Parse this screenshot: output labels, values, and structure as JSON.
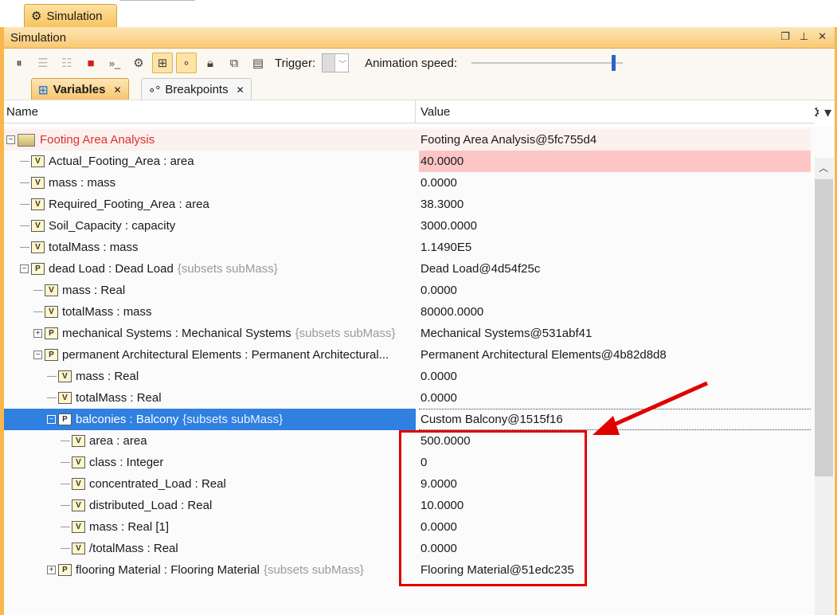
{
  "top_tab": {
    "label": "Simulation",
    "icon": "gear-icon"
  },
  "panel": {
    "title": "Simulation",
    "window_controls": [
      "restore-icon",
      "pin-icon",
      "close-icon"
    ]
  },
  "toolbar": {
    "trigger_label": "Trigger:",
    "animation_label": "Animation speed:",
    "animation_speed_fraction": 0.95
  },
  "subtabs": [
    {
      "label": "Variables",
      "active": true
    },
    {
      "label": "Breakpoints",
      "active": false
    }
  ],
  "columns": {
    "name": "Name",
    "value": "Value"
  },
  "rows": [
    {
      "indent": 0,
      "kind": "root",
      "expander": "minus",
      "name": "Footing Area Analysis",
      "subsets": "",
      "value": "Footing Area Analysis@5fc755d4"
    },
    {
      "indent": 1,
      "kind": "V",
      "expander": "",
      "name": "Actual_Footing_Area : area",
      "subsets": "",
      "value": "40.0000",
      "changed": true
    },
    {
      "indent": 1,
      "kind": "V",
      "expander": "",
      "name": "mass : mass",
      "subsets": "",
      "value": "0.0000"
    },
    {
      "indent": 1,
      "kind": "V",
      "expander": "",
      "name": "Required_Footing_Area : area",
      "subsets": "",
      "value": "38.3000"
    },
    {
      "indent": 1,
      "kind": "V",
      "expander": "",
      "name": "Soil_Capacity : capacity",
      "subsets": "",
      "value": "3000.0000"
    },
    {
      "indent": 1,
      "kind": "V",
      "expander": "",
      "name": "totalMass : mass",
      "subsets": "",
      "value": "1.1490E5"
    },
    {
      "indent": 1,
      "kind": "P",
      "expander": "minus",
      "name": "dead Load : Dead Load",
      "subsets": "{subsets subMass}",
      "value": "Dead Load@4d54f25c"
    },
    {
      "indent": 2,
      "kind": "V",
      "expander": "",
      "name": "mass : Real",
      "subsets": "",
      "value": "0.0000"
    },
    {
      "indent": 2,
      "kind": "V",
      "expander": "",
      "name": "totalMass : mass",
      "subsets": "",
      "value": "80000.0000"
    },
    {
      "indent": 2,
      "kind": "P",
      "expander": "plus",
      "name": "mechanical Systems : Mechanical Systems",
      "subsets": "{subsets subMass}",
      "value": "Mechanical Systems@531abf41"
    },
    {
      "indent": 2,
      "kind": "P",
      "expander": "minus",
      "name": "permanent Architectural Elements : Permanent Architectural...",
      "subsets": "",
      "value": "Permanent Architectural Elements@4b82d8d8"
    },
    {
      "indent": 3,
      "kind": "V",
      "expander": "",
      "name": "mass : Real",
      "subsets": "",
      "value": "0.0000"
    },
    {
      "indent": 3,
      "kind": "V",
      "expander": "",
      "name": "totalMass : Real",
      "subsets": "",
      "value": "0.0000"
    },
    {
      "indent": 3,
      "kind": "P",
      "expander": "minus",
      "name": "balconies : Balcony",
      "subsets": "{subsets subMass}",
      "value": "Custom Balcony@1515f16",
      "selected": true
    },
    {
      "indent": 4,
      "kind": "V",
      "expander": "",
      "name": "area : area",
      "subsets": "",
      "value": "500.0000"
    },
    {
      "indent": 4,
      "kind": "V",
      "expander": "",
      "name": "class : Integer",
      "subsets": "",
      "value": "0"
    },
    {
      "indent": 4,
      "kind": "V",
      "expander": "",
      "name": "concentrated_Load : Real",
      "subsets": "",
      "value": "9.0000"
    },
    {
      "indent": 4,
      "kind": "V",
      "expander": "",
      "name": "distributed_Load : Real",
      "subsets": "",
      "value": "10.0000"
    },
    {
      "indent": 4,
      "kind": "V",
      "expander": "",
      "name": "mass : Real [1]",
      "subsets": "",
      "value": "0.0000"
    },
    {
      "indent": 4,
      "kind": "V",
      "expander": "",
      "name": "/totalMass : Real",
      "subsets": "",
      "value": "0.0000"
    },
    {
      "indent": 3,
      "kind": "P",
      "expander": "plus",
      "name": "flooring Material : Flooring Material",
      "subsets": "{subsets subMass}",
      "value": "Flooring Material@51edc235"
    }
  ],
  "colors": {
    "accent": "#f8b64c",
    "selection": "#2f80e0",
    "changed_value": "#fcc6c6",
    "annotation": "#e00000"
  }
}
